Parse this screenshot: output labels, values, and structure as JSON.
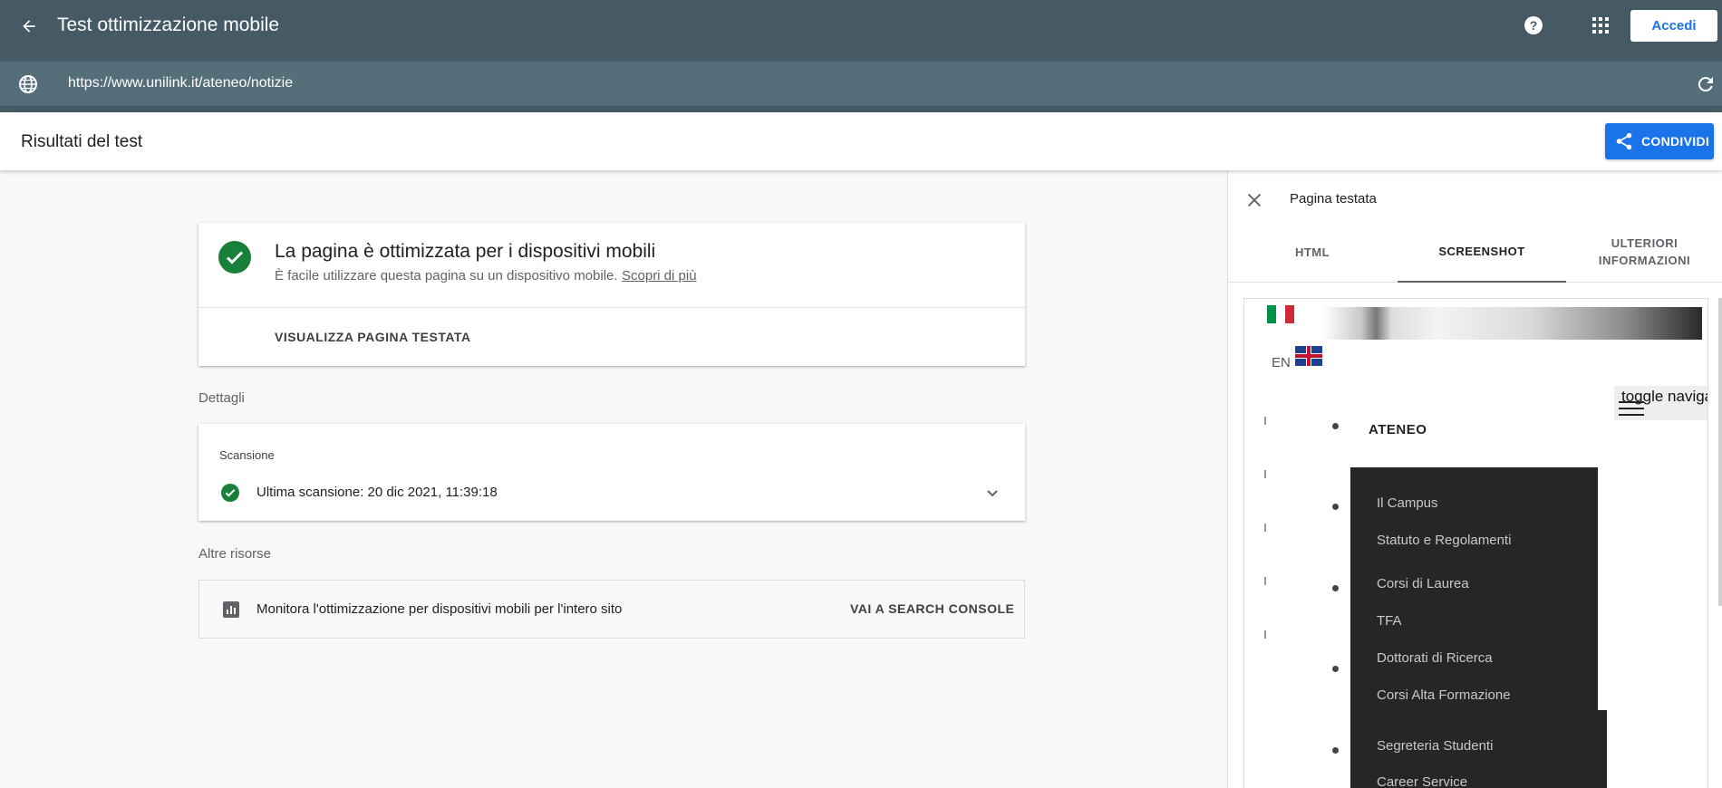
{
  "app": {
    "title": "Test ottimizzazione mobile",
    "login_label": "Accedi",
    "url": "https://www.unilink.it/ateneo/notizie"
  },
  "results": {
    "title": "Risultati del test",
    "share_label": "CONDIVIDI"
  },
  "main_card": {
    "heading": "La pagina è ottimizzata per i dispositivi mobili",
    "sub": "È facile utilizzare questa pagina su un dispositivo mobile.",
    "learn_more": "Scopri di più",
    "view_page": "VISUALIZZA PAGINA TESTATA"
  },
  "details": {
    "label": "Dettagli",
    "scan_title": "Scansione",
    "scan_text": "Ultima scansione: 20 dic 2021, 11:39:18"
  },
  "other_resources": {
    "label": "Altre risorse",
    "text": "Monitora l'ottimizzazione per dispositivi mobili per l'intero sito",
    "link": "VAI A SEARCH CONSOLE"
  },
  "side_panel": {
    "title": "Pagina testata",
    "tabs": [
      "HTML",
      "SCREENSHOT",
      "ULTERIORI INFORMAZIONI"
    ],
    "active_tab": "SCREENSHOT"
  },
  "screenshot": {
    "lang": "EN",
    "toggle_text": "toggle naviga",
    "nav_title": "ATENEO",
    "menu_items": [
      "Il Campus",
      "Statuto e Regolamenti",
      "Corsi di Laurea",
      "TFA",
      "Dottorati di Ricerca",
      "Corsi Alta Formazione",
      "Segreteria Studenti",
      "Career Service"
    ]
  },
  "colors": {
    "appbar": "#455a64",
    "urlbar": "#546e7a",
    "accent": "#1a73e8",
    "success": "#188038"
  },
  "icons": [
    "back-arrow-icon",
    "help-icon",
    "apps-grid-icon",
    "globe-icon",
    "reload-icon",
    "share-icon",
    "check-circle-icon",
    "chevron-down-icon",
    "bar-chart-icon",
    "close-icon",
    "hamburger-icon"
  ]
}
